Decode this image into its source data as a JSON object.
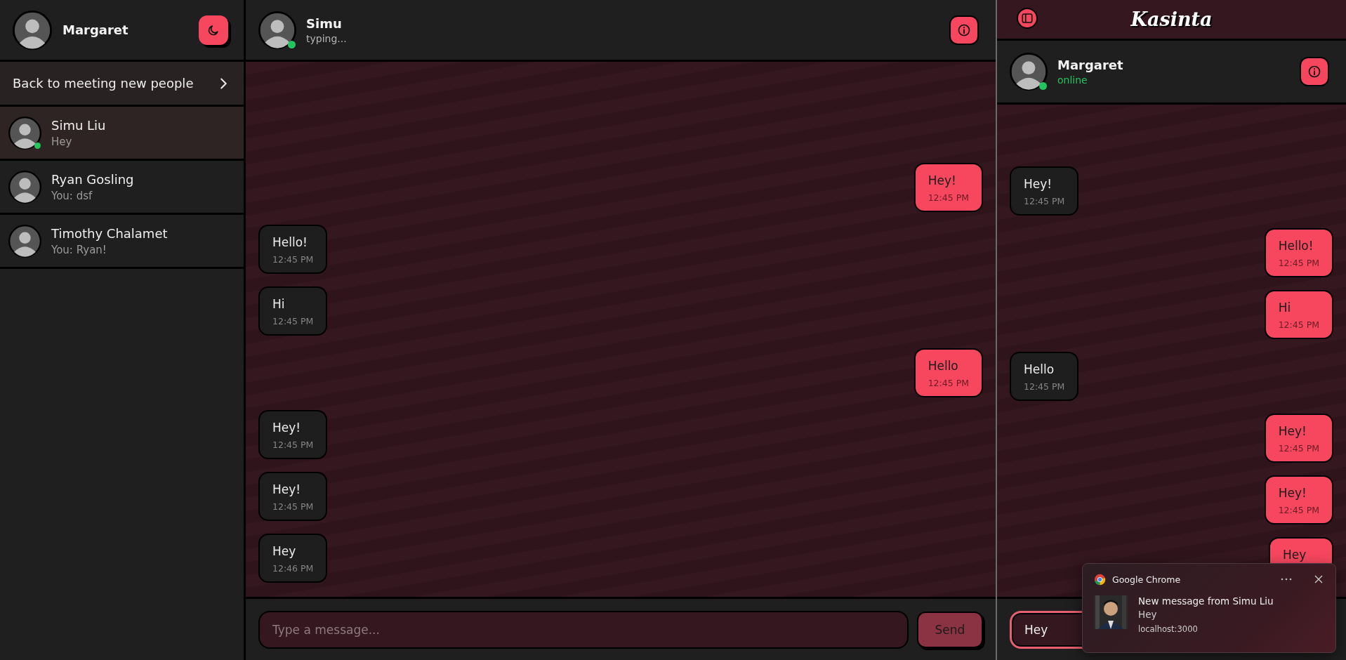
{
  "sidebar": {
    "user": {
      "name": "Margaret"
    },
    "back_link": {
      "label": "Back to meeting new people"
    },
    "contacts": [
      {
        "name": "Simu Liu",
        "preview": "Hey",
        "online": true,
        "selected": true
      },
      {
        "name": "Ryan Gosling",
        "preview": "You: dsf",
        "online": false,
        "selected": false
      },
      {
        "name": "Timothy Chalamet",
        "preview": "You: Ryan!",
        "online": false,
        "selected": false
      }
    ]
  },
  "chat": {
    "header": {
      "name": "Simu",
      "status": "typing...",
      "status_highlighted": false,
      "online": true
    },
    "messages": [
      {
        "outgoing": true,
        "text": "Hey!",
        "time": "12:45 PM"
      },
      {
        "outgoing": false,
        "text": "Hello!",
        "time": "12:45 PM"
      },
      {
        "outgoing": false,
        "text": "Hi",
        "time": "12:45 PM"
      },
      {
        "outgoing": true,
        "text": "Hello",
        "time": "12:45 PM"
      },
      {
        "outgoing": false,
        "text": "Hey!",
        "time": "12:45 PM"
      },
      {
        "outgoing": false,
        "text": "Hey!",
        "time": "12:45 PM"
      },
      {
        "outgoing": false,
        "text": "Hey",
        "time": "12:46 PM"
      }
    ],
    "input": {
      "placeholder": "Type a message..."
    },
    "send_button": "Send"
  },
  "preview_panel": {
    "brand": "Kasinta",
    "header": {
      "name": "Margaret",
      "status": "online",
      "status_highlighted": true,
      "online": true
    },
    "messages": [
      {
        "outgoing": false,
        "text": "Hey!",
        "time": "12:45 PM"
      },
      {
        "outgoing": true,
        "text": "Hello!",
        "time": "12:45 PM"
      },
      {
        "outgoing": true,
        "text": "Hi",
        "time": "12:45 PM"
      },
      {
        "outgoing": false,
        "text": "Hello",
        "time": "12:45 PM"
      },
      {
        "outgoing": true,
        "text": "Hey!",
        "time": "12:45 PM"
      },
      {
        "outgoing": true,
        "text": "Hey!",
        "time": "12:45 PM"
      },
      {
        "outgoing": true,
        "text": "Hey"
      }
    ],
    "input": {
      "value": "Hey"
    }
  },
  "notification": {
    "app": "Google Chrome",
    "title": "New message from Simu Liu",
    "body": "Hey",
    "source": "localhost:3000"
  }
}
